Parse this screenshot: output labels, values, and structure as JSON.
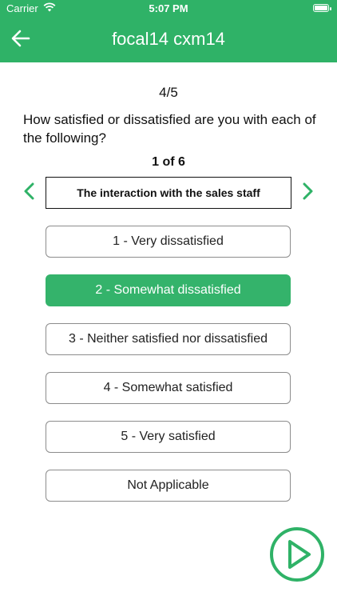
{
  "status_bar": {
    "carrier": "Carrier",
    "time": "5:07 PM"
  },
  "nav": {
    "title": "focal14 cxm14",
    "back_icon": "arrow-left-icon"
  },
  "survey": {
    "progress": "4/5",
    "question": "How satisfied or dissatisfied are you with each of the following?",
    "item_counter": "1 of 6",
    "current_item": "The interaction with the sales staff",
    "prev_icon": "chevron-left-icon",
    "next_icon": "chevron-right-icon",
    "options": [
      {
        "label": "1 - Very dissatisfied",
        "selected": false
      },
      {
        "label": "2 - Somewhat dissatisfied",
        "selected": true
      },
      {
        "label": "3 - Neither satisfied nor dissatisfied",
        "selected": false
      },
      {
        "label": "4 - Somewhat satisfied",
        "selected": false
      },
      {
        "label": "5 - Very satisfied",
        "selected": false
      },
      {
        "label": "Not Applicable",
        "selected": false
      }
    ],
    "next_button_icon": "play-icon"
  },
  "colors": {
    "accent": "#2fb267",
    "selected_option": "#34b36b"
  }
}
